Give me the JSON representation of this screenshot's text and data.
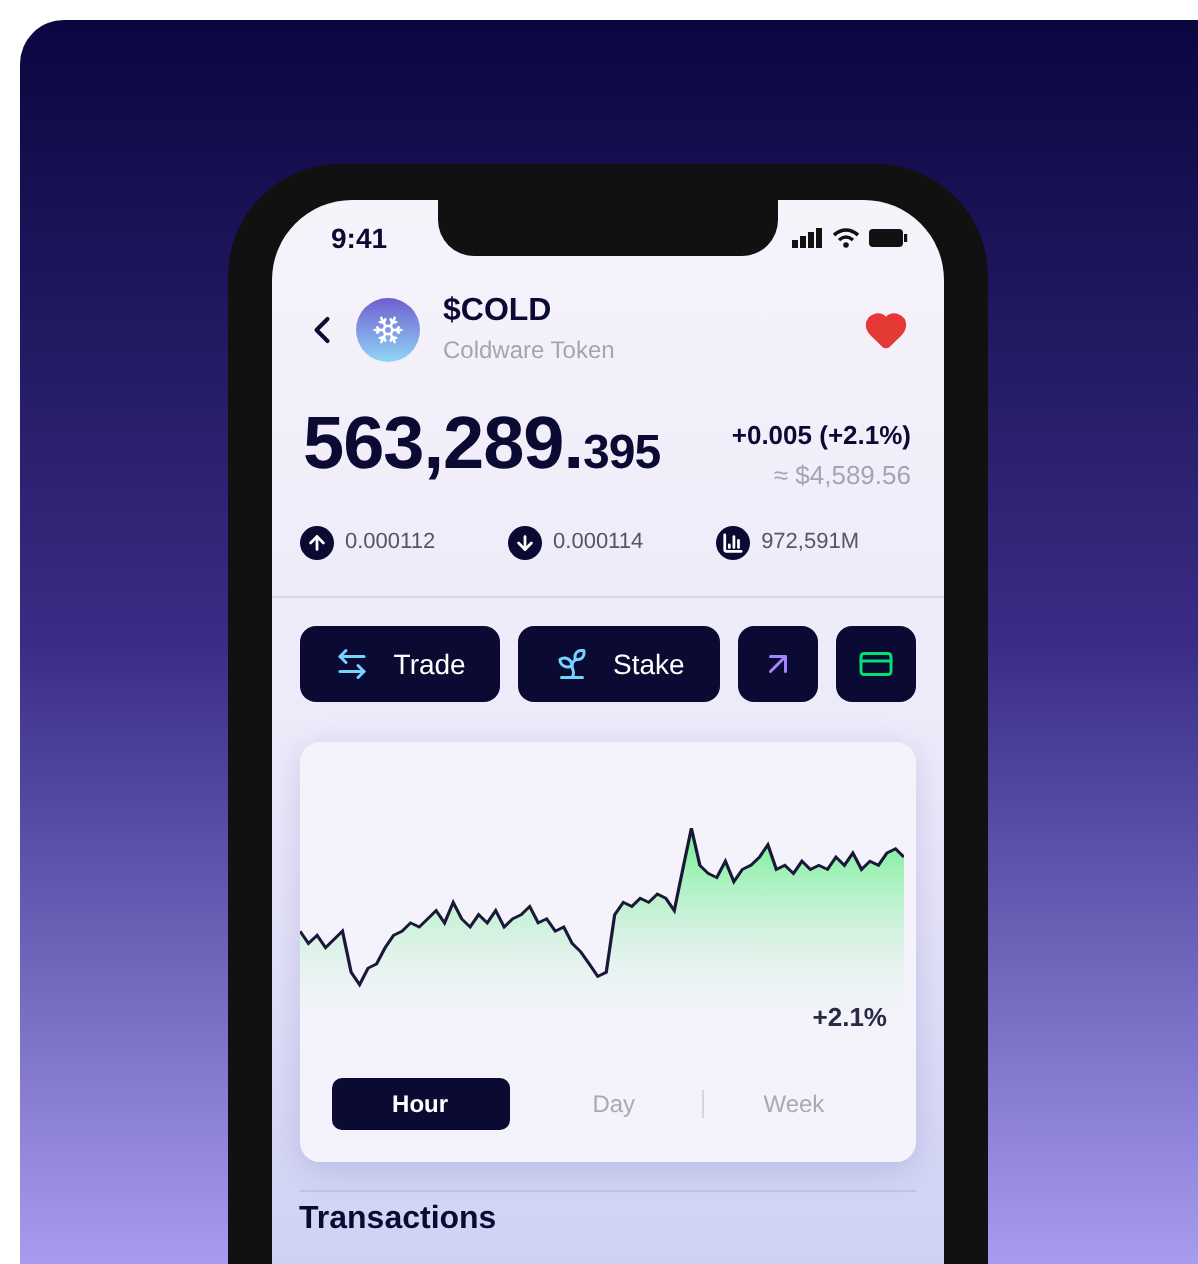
{
  "status_bar": {
    "time": "9:41"
  },
  "token": {
    "symbol": "$COLD",
    "name": "Coldware Token",
    "favorite": true
  },
  "price": {
    "whole": "563,289.",
    "fraction": "395",
    "change": "+0.005 (+2.1%)",
    "fiat": "≈ $4,589.56"
  },
  "stats": [
    {
      "kind": "up",
      "value": "0.000112"
    },
    {
      "kind": "down",
      "value": "0.000114"
    },
    {
      "kind": "volume",
      "value": "972,591M"
    }
  ],
  "actions": [
    {
      "kind": "trade",
      "label": "Trade"
    },
    {
      "kind": "stake",
      "label": "Stake"
    },
    {
      "kind": "send"
    },
    {
      "kind": "card"
    }
  ],
  "chart": {
    "change": "+2.1%"
  },
  "periods": [
    {
      "label": "Hour",
      "selected": true
    },
    {
      "label": "Day",
      "selected": false
    },
    {
      "label": "Week",
      "selected": false
    }
  ],
  "section_title": "Transactions"
}
